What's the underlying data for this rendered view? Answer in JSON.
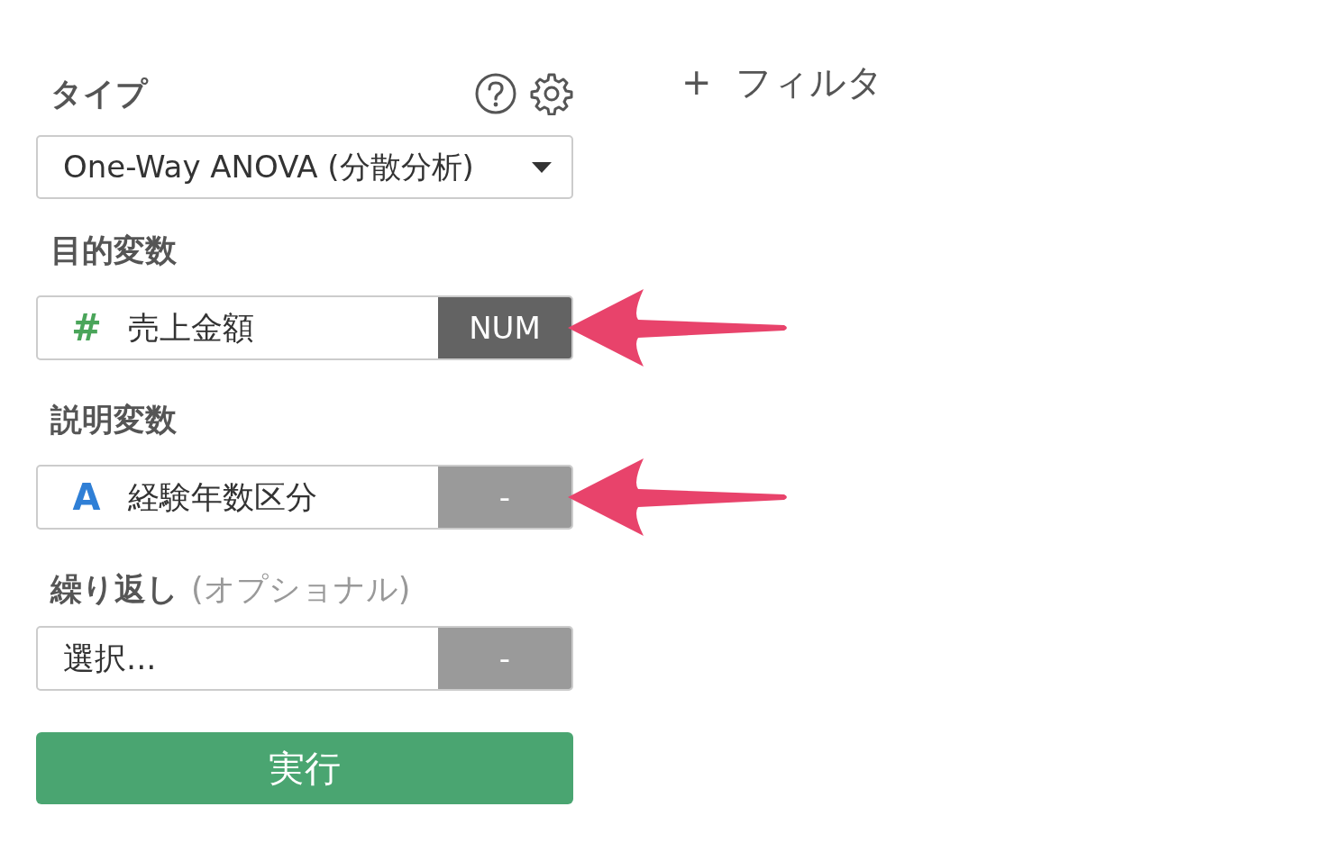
{
  "type_section": {
    "label": "タイプ",
    "dropdown": {
      "value": "One-Way ANOVA (分散分析)"
    }
  },
  "fields": [
    {
      "label": "目的変数",
      "icon": "#",
      "kind": "number",
      "value": "売上金額",
      "badge": "NUM",
      "badge_active": true,
      "highlighted": true
    },
    {
      "label": "説明変数",
      "icon": "A",
      "kind": "text",
      "value": "経験年数区分",
      "badge": "-",
      "badge_active": false,
      "highlighted": true
    },
    {
      "label": "繰り返し",
      "optional_note": "(オプショナル)",
      "placeholder": "選択...",
      "badge": "-",
      "badge_active": false,
      "highlighted": false
    }
  ],
  "run_button": {
    "label": "実行"
  },
  "filter": {
    "plus": "+",
    "label": "フィルタ"
  }
}
